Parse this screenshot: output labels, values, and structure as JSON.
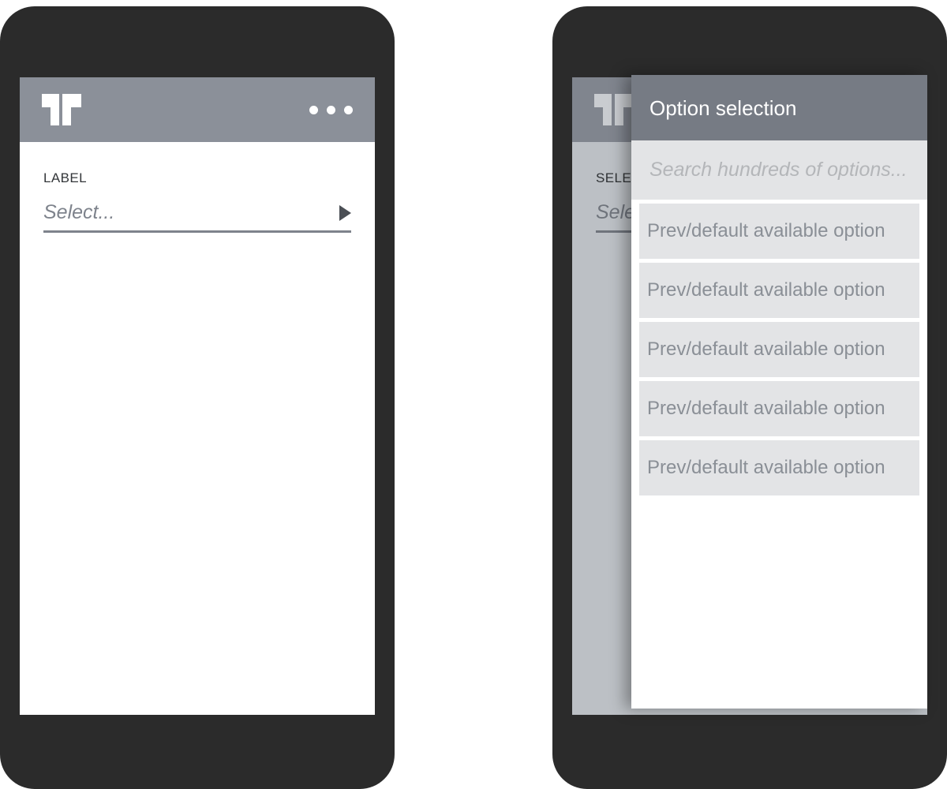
{
  "app": {
    "logo_icon": "double-t-logo-icon",
    "overflow_menu_icon": "three-dots-icon"
  },
  "phone_left": {
    "form": {
      "label": "LABEL",
      "select_value": "Select...",
      "select_placeholder": "Select...",
      "caret_icon": "caret-right-icon"
    }
  },
  "phone_right": {
    "form": {
      "label": "SELECT",
      "select_value": "Select...",
      "select_placeholder": "Select..."
    },
    "modal": {
      "title": "Option selection",
      "search_placeholder": "Search hundreds of options...",
      "search_value": "",
      "options": [
        {
          "label": "Prev/default available option"
        },
        {
          "label": "Prev/default available option"
        },
        {
          "label": "Prev/default available option"
        },
        {
          "label": "Prev/default available option"
        },
        {
          "label": "Prev/default available option"
        }
      ]
    }
  },
  "colors": {
    "frame": "#2b2b2b",
    "appbar": "#8b9099",
    "modal_header": "#767b84",
    "search_bg": "#e3e4e6",
    "option_bg": "#e3e4e6",
    "option_text": "#8a8f96",
    "dimmed_body": "#bcc0c5",
    "screen_bg": "#ffffff"
  }
}
